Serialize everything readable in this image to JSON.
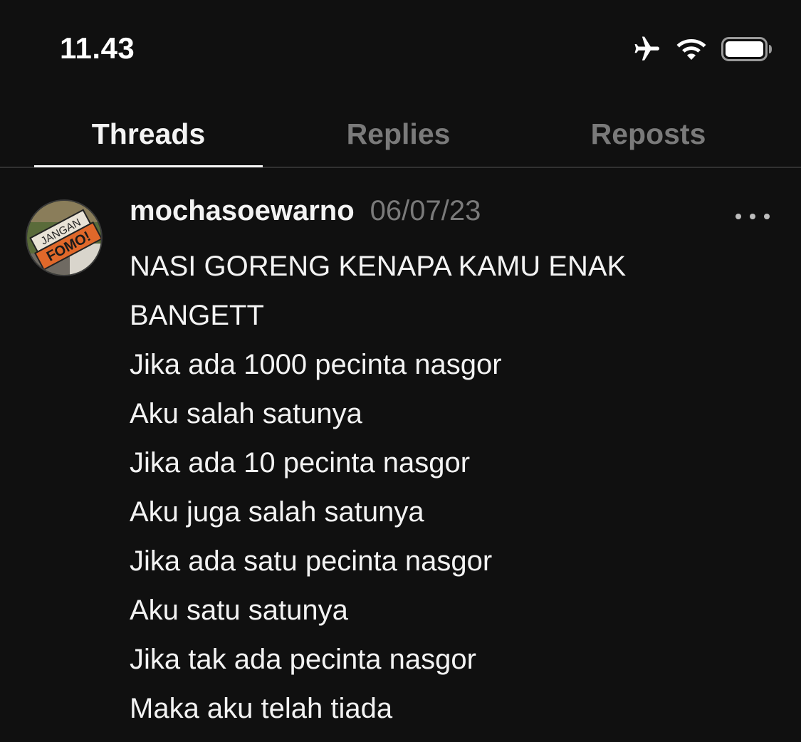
{
  "status_bar": {
    "time": "11.43",
    "icons": [
      "airplane-icon",
      "wifi-icon",
      "battery-icon"
    ]
  },
  "tabs": [
    {
      "label": "Threads",
      "active": true
    },
    {
      "label": "Replies",
      "active": false
    },
    {
      "label": "Reposts",
      "active": false
    }
  ],
  "post": {
    "avatar_text": [
      "JANGAN",
      "FOMO!"
    ],
    "username": "mochasoewarno",
    "date": "06/07/23",
    "more_icon": "more-horizontal-icon",
    "lines": [
      "NASI GORENG KENAPA KAMU ENAK",
      "BANGETT",
      "Jika ada 1000 pecinta nasgor",
      "Aku salah satunya",
      "Jika ada 10 pecinta nasgor",
      "Aku juga salah satunya",
      "Jika ada satu pecinta nasgor",
      "Aku satu satunya",
      "Jika tak ada pecinta nasgor",
      "Maka aku telah tiada"
    ]
  },
  "colors": {
    "background": "#101010",
    "text_primary": "#f3f3f3",
    "text_secondary": "#7a7a7a",
    "divider": "#323232"
  }
}
